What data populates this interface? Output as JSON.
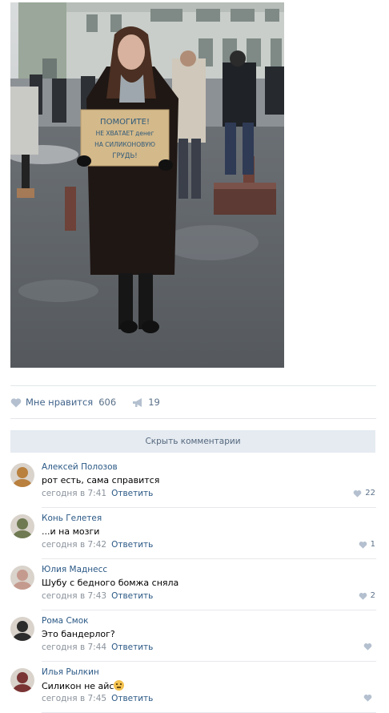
{
  "post": {
    "sign_text": [
      "ПОМОГИТЕ!",
      "НЕ ХВАТАЕТ денег",
      "НА СИЛИКОНОВУЮ",
      "ГРУДЬ!"
    ],
    "likes_label": "Мне нравится",
    "likes_count": "606",
    "shares_count": "19",
    "hide_comments_label": "Скрыть комментарии"
  },
  "comments": [
    {
      "author": "Алексей Полозов",
      "text": "рот есть, сама справится",
      "time": "сегодня в 7:41",
      "reply": "Ответить",
      "likes": "22",
      "avatar_color": "#b9803e"
    },
    {
      "author": "Конь Гелетея",
      "text": "...и на мозги",
      "time": "сегодня в 7:42",
      "reply": "Ответить",
      "likes": "1",
      "avatar_color": "#6f7a52"
    },
    {
      "author": "Юлия Маднесс",
      "text": "Шубу с бедного бомжа сняла",
      "time": "сегодня в 7:43",
      "reply": "Ответить",
      "likes": "2",
      "avatar_color": "#c59a8e"
    },
    {
      "author": "Рома Смок",
      "text": "Это бандерлог?",
      "time": "сегодня в 7:44",
      "reply": "Ответить",
      "likes": "",
      "avatar_color": "#2c2c2c"
    },
    {
      "author": "Илья Рылкин",
      "text": "Силикон не айс",
      "time": "сегодня в 7:45",
      "reply": "Ответить",
      "likes": "",
      "avatar_color": "#7a3434"
    }
  ]
}
